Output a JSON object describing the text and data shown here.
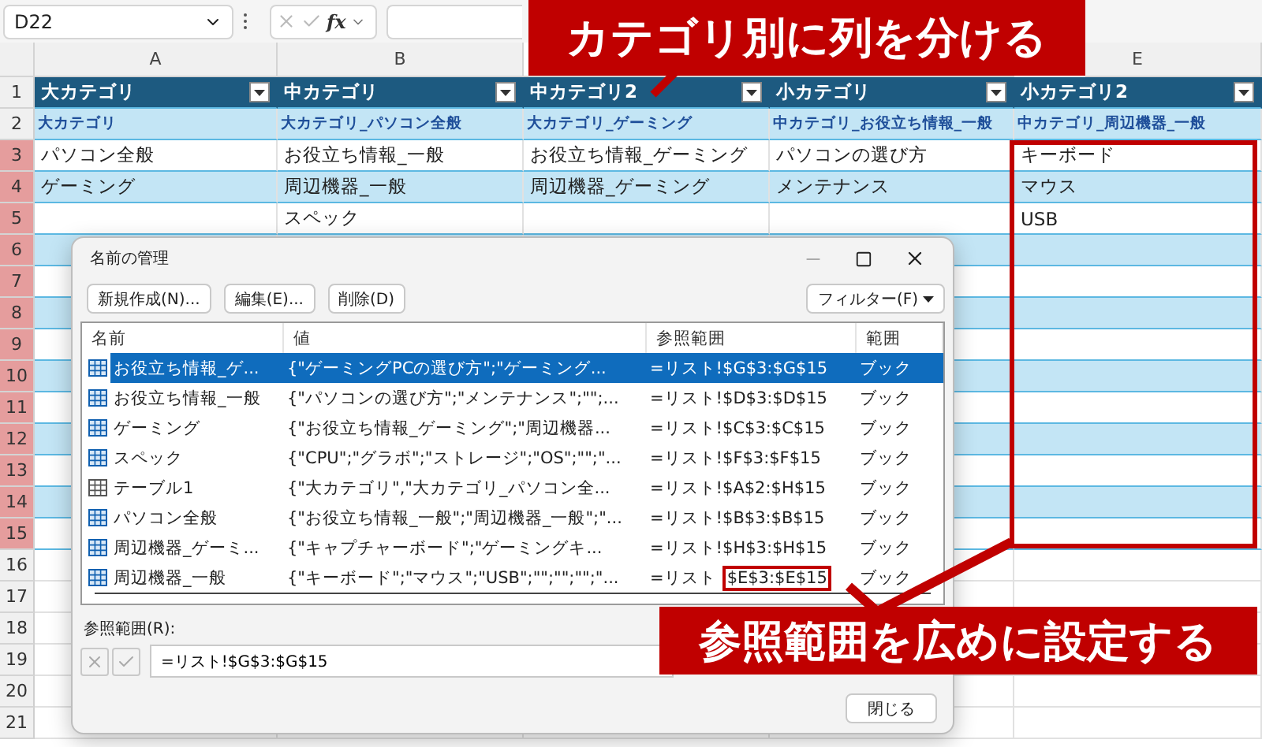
{
  "formula_bar": {
    "name_box": "D22",
    "function_label": "fx"
  },
  "columns": [
    "A",
    "B",
    "E"
  ],
  "rows": [
    {
      "number": "1",
      "highlighted": false,
      "kind": "header",
      "cells": {
        "A": "大カテゴリ",
        "B": "中カテゴリ",
        "C": "中カテゴリ2",
        "D": "小カテゴリ",
        "E": "小カテゴリ2"
      }
    },
    {
      "number": "2",
      "highlighted": false,
      "kind": "label",
      "cells": {
        "A": "大カテゴリ",
        "B": "大カテゴリ_パソコン全般",
        "C": "大カテゴリ_ゲーミング",
        "D": "中カテゴリ_お役立ち情報_一般",
        "E": "中カテゴリ_周辺機器_一般"
      }
    },
    {
      "number": "3",
      "highlighted": true,
      "kind": "data",
      "cells": {
        "A": "パソコン全般",
        "B": "お役立ち情報_一般",
        "C": "お役立ち情報_ゲーミング",
        "D": "パソコンの選び方",
        "E": "キーボード"
      }
    },
    {
      "number": "4",
      "highlighted": true,
      "kind": "data",
      "cells": {
        "A": "ゲーミング",
        "B": "周辺機器_一般",
        "C": "周辺機器_ゲーミング",
        "D": "メンテナンス",
        "E": "マウス"
      }
    },
    {
      "number": "5",
      "highlighted": true,
      "kind": "data",
      "cells": {
        "B": "スペック",
        "E": "USB"
      }
    },
    {
      "number": "6",
      "highlighted": true,
      "kind": "data"
    },
    {
      "number": "7",
      "highlighted": true,
      "kind": "data"
    },
    {
      "number": "8",
      "highlighted": true,
      "kind": "data"
    },
    {
      "number": "9",
      "highlighted": true,
      "kind": "data"
    },
    {
      "number": "10",
      "highlighted": true,
      "kind": "data"
    },
    {
      "number": "11",
      "highlighted": true,
      "kind": "data"
    },
    {
      "number": "12",
      "highlighted": true,
      "kind": "data"
    },
    {
      "number": "13",
      "highlighted": true,
      "kind": "data"
    },
    {
      "number": "14",
      "highlighted": true,
      "kind": "data"
    },
    {
      "number": "15",
      "highlighted": true,
      "kind": "data"
    },
    {
      "number": "16",
      "highlighted": false,
      "kind": "blank"
    },
    {
      "number": "17",
      "highlighted": false,
      "kind": "blank"
    },
    {
      "number": "18",
      "highlighted": false,
      "kind": "blank"
    },
    {
      "number": "19",
      "highlighted": false,
      "kind": "blank"
    },
    {
      "number": "20",
      "highlighted": false,
      "kind": "blank"
    },
    {
      "number": "21",
      "highlighted": false,
      "kind": "blank"
    }
  ],
  "dialog": {
    "title": "名前の管理",
    "buttons": [
      "新規作成(N)...",
      "編集(E)...",
      "削除(D)"
    ],
    "filter": "フィルター(F)",
    "list_columns": [
      "名前",
      "値",
      "参照範囲",
      "範囲"
    ],
    "items": [
      {
        "kind": "name",
        "name": "お役立ち情報_ゲ...",
        "value": "{\"ゲーミングPCの選び方\";\"ゲーミング...",
        "ref": "=リスト!$G$3:$G$15",
        "scope": "ブック",
        "selected": true
      },
      {
        "kind": "name",
        "name": "お役立ち情報_一般",
        "value": "{\"パソコンの選び方\";\"メンテナンス\";\"\";...",
        "ref": "=リスト!$D$3:$D$15",
        "scope": "ブック",
        "selected": false
      },
      {
        "kind": "name",
        "name": "ゲーミング",
        "value": "{\"お役立ち情報_ゲーミング\";\"周辺機器...",
        "ref": "=リスト!$C$3:$C$15",
        "scope": "ブック",
        "selected": false
      },
      {
        "kind": "name",
        "name": "スペック",
        "value": "{\"CPU\";\"グラボ\";\"ストレージ\";\"OS\";\"\";\"...",
        "ref": "=リスト!$F$3:$F$15",
        "scope": "ブック",
        "selected": false
      },
      {
        "kind": "table",
        "name": "テーブル1",
        "value": "{\"大カテゴリ\",\"大カテゴリ_パソコン全...",
        "ref": "=リスト!$A$2:$H$15",
        "scope": "ブック",
        "selected": false
      },
      {
        "kind": "name",
        "name": "パソコン全般",
        "value": "{\"お役立ち情報_一般\";\"周辺機器_一般\";\"...",
        "ref": "=リスト!$B$3:$B$15",
        "scope": "ブック",
        "selected": false
      },
      {
        "kind": "name",
        "name": "周辺機器_ゲーミ...",
        "value": "{\"キャプチャーボード\";\"ゲーミングキ...",
        "ref": "=リスト!$H$3:$H$15",
        "scope": "ブック",
        "selected": false
      },
      {
        "kind": "name",
        "name": "周辺機器_一般",
        "value": "{\"キーボード\";\"マウス\";\"USB\";\"\";\"\";\"\";\"...",
        "ref": "=リスト",
        "ref_highlighted": "$E$3:$E$15",
        "scope": "ブック",
        "selected": false
      }
    ],
    "ref_label": "参照範囲(R):",
    "ref_value": "=リスト!$G$3:$G$15",
    "close": "閉じる"
  },
  "callouts": [
    {
      "text": "カテゴリ別に列を分ける"
    },
    {
      "text": "参照範囲を広めに設定する"
    }
  ]
}
